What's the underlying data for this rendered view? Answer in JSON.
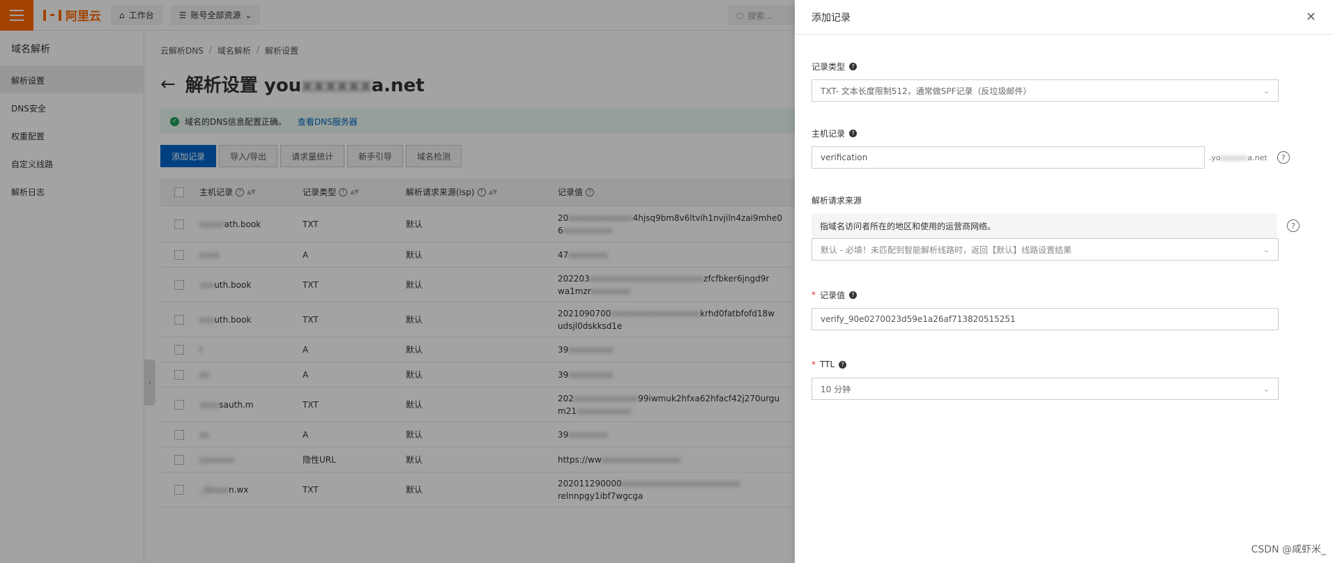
{
  "topbar": {
    "logo_text": "阿里云",
    "workbench": "工作台",
    "account_resources": "账号全部资源",
    "search_placeholder": "搜索..."
  },
  "sidebar": {
    "title": "域名解析",
    "items": [
      {
        "label": "解析设置",
        "active": true
      },
      {
        "label": "DNS安全"
      },
      {
        "label": "权重配置"
      },
      {
        "label": "自定义线路"
      },
      {
        "label": "解析日志"
      }
    ]
  },
  "breadcrumb": [
    "云解析DNS",
    "域名解析",
    "解析设置"
  ],
  "page": {
    "title_prefix": "解析设置",
    "domain_start": "you",
    "domain_hidden": "xxxxxx",
    "domain_end": "a.net"
  },
  "notice": {
    "text": "域名的DNS信息配置正确。",
    "link": "查看DNS服务器"
  },
  "toolbar": [
    "添加记录",
    "导入/导出",
    "请求量统计",
    "新手引导",
    "域名检测"
  ],
  "table": {
    "headers": {
      "host": "主机记录",
      "type": "记录类型",
      "line": "解析请求来源(isp)",
      "value": "记录值"
    },
    "rows": [
      {
        "host_hidden": "xxxxx",
        "host": "ath.book",
        "type": "TXT",
        "line": "默认",
        "value_start": "20",
        "value_hidden": "xxxxxxxxxxxxx",
        "value_end": "4hjsq9bm8v6ltvih1nvjiln4zai9mhe0",
        "value_2": "6",
        "value_2_hidden": "xxxxxxxxxx",
        "h": 52
      },
      {
        "host_hidden": "xxxx",
        "host": "",
        "type": "A",
        "line": "默认",
        "value_start": "47",
        "value_hidden": "xxxxxxxx",
        "value_end": "",
        "value_2": "",
        "value_2_hidden": "",
        "h": 36
      },
      {
        "host_hidden": "xxx",
        "host": "uth.book",
        "type": "TXT",
        "line": "默认",
        "value_start": "202203",
        "value_hidden": "xxxxxxxxxxxxxxxxxxxxxxx",
        "value_end": "zfcfbker6jngd9r",
        "value_2": "wa1mzr",
        "value_2_hidden": "xxxxxxxx",
        "h": 50
      },
      {
        "host_hidden": "xxx",
        "host": "uth.book",
        "type": "TXT",
        "line": "默认",
        "value_start": "2021090700",
        "value_hidden": "xxxxxxxxxxxxxxxxxx",
        "value_end": "krhd0fatbfofd18w",
        "value_2": "udsjl0dskksd1e",
        "value_2_hidden": "",
        "h": 50
      },
      {
        "host_hidden": "t",
        "host": "",
        "type": "A",
        "line": "默认",
        "value_start": "39",
        "value_hidden": "xxxxxxxxx",
        "value_end": "",
        "value_2": "",
        "value_2_hidden": "",
        "h": 36
      },
      {
        "host_hidden": "xx",
        "host": "",
        "type": "A",
        "line": "默认",
        "value_start": "39",
        "value_hidden": "xxxxxxxxx",
        "value_end": "",
        "value_2": "",
        "value_2_hidden": "",
        "h": 36
      },
      {
        "host_hidden": "xxxx",
        "host": "sauth.m",
        "type": "TXT",
        "line": "默认",
        "value_start": "202",
        "value_hidden": "xxxxxxxxxxxxx",
        "value_end": "99iwmuk2hfxa62hfacf42j270urgu",
        "value_2": "m21",
        "value_2_hidden": "xxxxxxxxxxx",
        "h": 50
      },
      {
        "host_hidden": "xx",
        "host": "",
        "type": "A",
        "line": "默认",
        "value_start": "39",
        "value_hidden": "xxxxxxxx",
        "value_end": "",
        "value_2": "",
        "value_2_hidden": "",
        "h": 36
      },
      {
        "host_hidden": "yxxxxxx",
        "host": "",
        "type": "隐性URL",
        "line": "默认",
        "value_start": "https://ww",
        "value_hidden": "xxxxxxxxxxxxxxxx",
        "value_end": "",
        "value_2": "",
        "value_2_hidden": "",
        "h": 36
      },
      {
        "host_hidden": "_dxxxx",
        "host": "n.wx",
        "type": "TXT",
        "line": "默认",
        "value_start": "202011290000",
        "value_hidden": "xxxxxxxxxxxxxxxxxxxxxxxx",
        "value_end": "",
        "value_2": "relnnpgy1ibf7wgcga",
        "value_2_hidden": "",
        "h": 50
      }
    ]
  },
  "drawer": {
    "title": "添加记录",
    "record_type_label": "记录类型",
    "record_type_value": "TXT- 文本长度限制512，通常做SPF记录（反垃圾邮件）",
    "host_label": "主机记录",
    "host_value": "verification",
    "host_suffix_start": ".yo",
    "host_suffix_hidden": "xxxxxx",
    "host_suffix_end": "a.net",
    "line_label": "解析请求来源",
    "line_hint": "指域名访问者所在的地区和使用的运营商网络。",
    "line_value": "默认 - 必填！未匹配到智能解析线路时，返回【默认】线路设置结果",
    "value_label": "记录值",
    "value_value": "verify_90e0270023d59e1a26af713820515251",
    "ttl_label": "TTL",
    "ttl_value": "10 分钟"
  },
  "watermark": "CSDN @咸虾米_"
}
